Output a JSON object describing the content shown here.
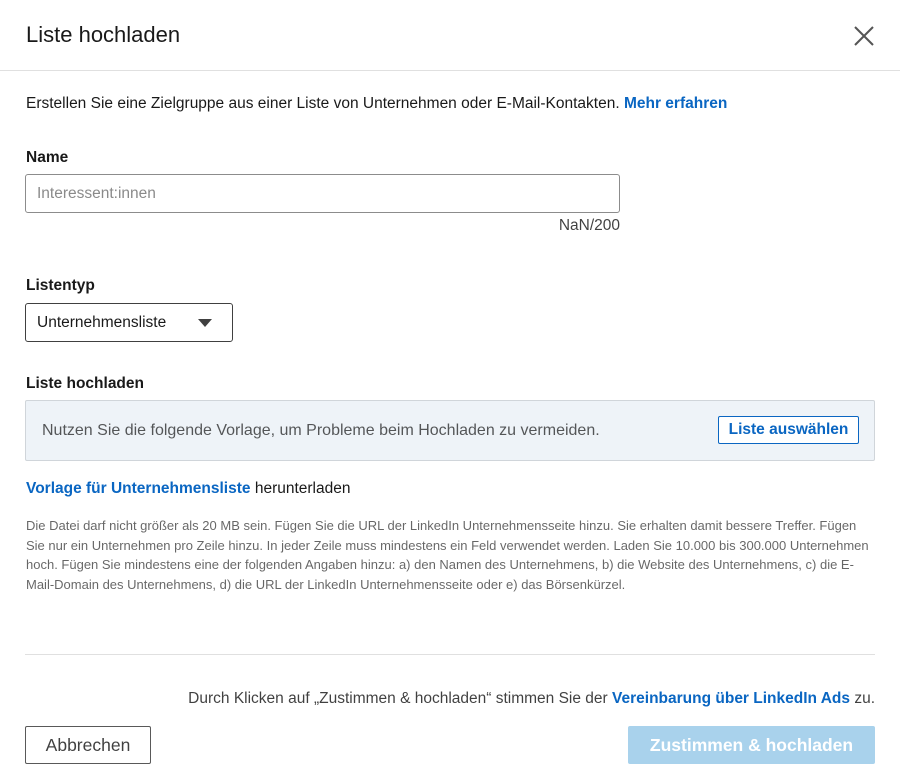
{
  "dialog": {
    "title": "Liste hochladen",
    "close_icon": "close-icon"
  },
  "intro": {
    "text": "Erstellen Sie eine Zielgruppe aus einer Liste von Unternehmen oder E-Mail-Kontakten. ",
    "link": "Mehr erfahren"
  },
  "name_field": {
    "label": "Name",
    "value": "",
    "placeholder": "Interessent:innen",
    "counter": "NaN/200"
  },
  "list_type": {
    "label": "Listentyp",
    "selected": "Unternehmensliste",
    "icon": "caret-down-icon"
  },
  "upload": {
    "label": "Liste hochladen",
    "hint": "Nutzen Sie die folgende Vorlage, um Probleme beim Hochladen zu vermeiden.",
    "button": "Liste auswählen"
  },
  "template_download": {
    "link": "Vorlage für Unternehmensliste",
    "suffix": " herunterladen"
  },
  "help_text": "Die Datei darf nicht größer als 20 MB sein. Fügen Sie die URL der LinkedIn Unternehmensseite hinzu. Sie erhalten damit bessere Treffer. Fügen Sie nur ein Unternehmen pro Zeile hinzu. In jeder Zeile muss mindestens ein Feld verwendet werden. Laden Sie 10.000 bis 300.000 Unternehmen hoch. Fügen Sie mindestens eine der folgenden Angaben hinzu: a) den Namen des Unternehmens, b) die Website des Unternehmens, c) die E-Mail-Domain des Unternehmens, d) die URL der LinkedIn Unternehmensseite oder e) das Börsenkürzel.",
  "footer": {
    "agreement_prefix": "Durch Klicken auf „Zustimmen & hochladen“ stimmen Sie der ",
    "agreement_link": "Vereinbarung über LinkedIn Ads",
    "agreement_suffix": " zu.",
    "cancel": "Abbrechen",
    "submit": "Zustimmen & hochladen"
  },
  "colors": {
    "link": "#0a66c2",
    "submit_disabled_bg": "#a9d2ec",
    "upload_box_bg": "#eef3f8"
  }
}
